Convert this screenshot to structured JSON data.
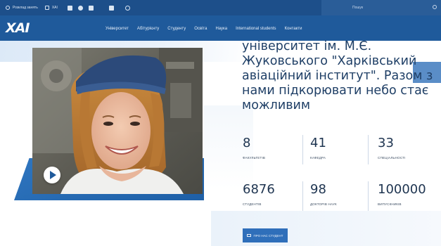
{
  "topbar": {
    "dictionary_label": "Розклад занять",
    "mail_label": "XAI",
    "search_placeholder": "Пошук"
  },
  "navbar": {
    "logo": "XAI",
    "menu": [
      "Університет",
      "Абітурієнту",
      "Студенту",
      "Освіта",
      "Наука",
      "International students",
      "Контакти"
    ]
  },
  "headline": "університет ім. М.Є.\nЖуковського \"Харківський\nавіаційний інститут\". Разом з\nнами підкорювати небо стає\nможливим",
  "stats": [
    {
      "value": "8",
      "label": "ФАКУЛЬТЕТІВ"
    },
    {
      "value": "41",
      "label": "КАФЕДРА"
    },
    {
      "value": "33",
      "label": "СПЕЦІАЛЬНОСТІ"
    },
    {
      "value": "6876",
      "label": "СТУДЕНТІВ"
    },
    {
      "value": "98",
      "label": "ДОКТОРІВ НАУК"
    },
    {
      "value": "100000",
      "label": "ВИПУСКНИКІВ"
    }
  ],
  "cta_label": "ПРО НАС СТУДЕНТ",
  "colors": {
    "topbar": "#1d4f8a",
    "navbar": "#1f5a9b",
    "accent": "#2f6fba",
    "headline": "#1f3f66"
  }
}
